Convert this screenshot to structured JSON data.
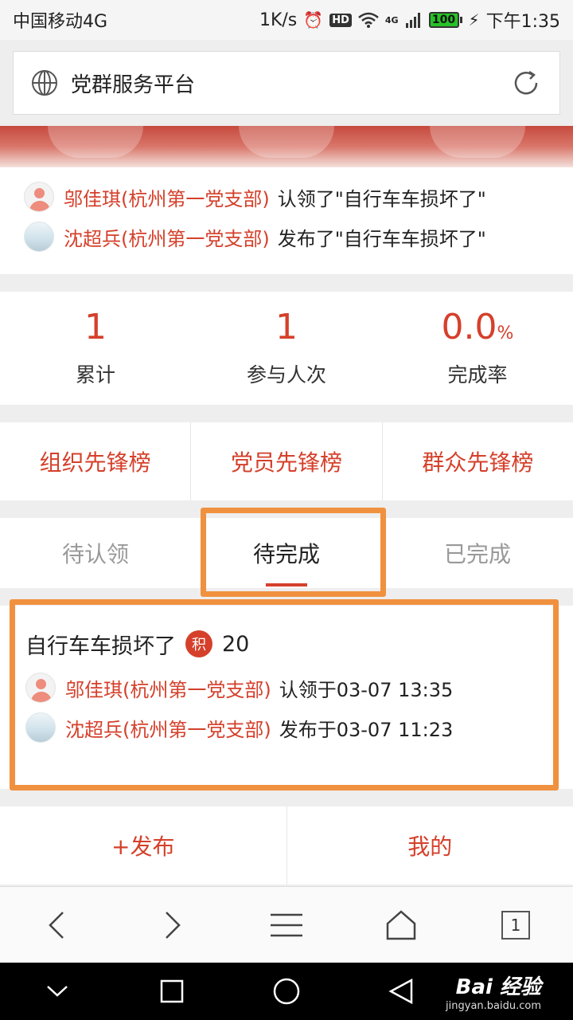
{
  "statusbar": {
    "carrier": "中国移动4G",
    "speed": "1K/s",
    "hd": "HD",
    "network": "4G",
    "battery": "100",
    "time": "下午1:35"
  },
  "address": {
    "title": "党群服务平台"
  },
  "feed": [
    {
      "name": "邬佳琪(杭州第一党支部)",
      "action": "认领了\"自行车车损坏了\"",
      "avatar": "person"
    },
    {
      "name": "沈超兵(杭州第一党支部)",
      "action": "发布了\"自行车车损坏了\"",
      "avatar": "scenery"
    }
  ],
  "stats": [
    {
      "value": "1",
      "unit": "",
      "label": "累计"
    },
    {
      "value": "1",
      "unit": "",
      "label": "参与人次"
    },
    {
      "value": "0.0",
      "unit": "%",
      "label": "完成率"
    }
  ],
  "boards": [
    "组织先锋榜",
    "党员先锋榜",
    "群众先锋榜"
  ],
  "tabs": [
    {
      "label": "待认领",
      "active": false
    },
    {
      "label": "待完成",
      "active": true
    },
    {
      "label": "已完成",
      "active": false
    }
  ],
  "task": {
    "title": "自行车车损坏了",
    "badge": "积",
    "points": "20",
    "records": [
      {
        "name": "邬佳琪(杭州第一党支部)",
        "action": "认领于03-07 13:35",
        "avatar": "person"
      },
      {
        "name": "沈超兵(杭州第一党支部)",
        "action": "发布于03-07 11:23",
        "avatar": "scenery"
      }
    ]
  },
  "actions": {
    "publish": "+发布",
    "mine": "我的"
  },
  "browser_nav": {
    "tab_count": "1"
  },
  "watermark": {
    "text": "Bai 经验",
    "url": "jingyan.baidu.com"
  },
  "colors": {
    "accent": "#d5402b",
    "highlight": "#f0913f"
  }
}
